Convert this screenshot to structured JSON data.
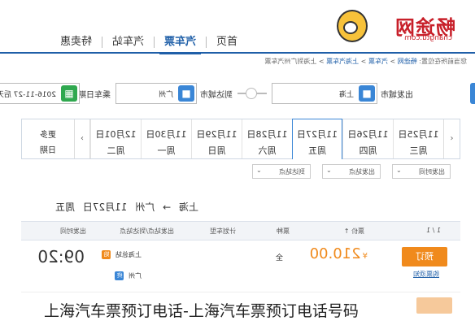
{
  "header": {
    "logo_text": "畅途网",
    "logo_sub": "changtu.com",
    "nav": [
      "首页",
      "汽车票",
      "汽车站",
      "特卖惠"
    ],
    "active_nav": "汽车票"
  },
  "breadcrumb": [
    "您当前所在位置:",
    "畅途网",
    "汽车票",
    "上海汽车票",
    "上海到广州汽车票"
  ],
  "search": {
    "from_label": "出发城市",
    "from_value": "上海",
    "to_label": "到达城市",
    "to_value": "广州",
    "date_label": "乘车日期",
    "date_value": "2016-11-27  后天"
  },
  "date_tabs": [
    {
      "date": "11月25日",
      "day": "周三"
    },
    {
      "date": "11月26日",
      "day": "周四"
    },
    {
      "date": "11月27日",
      "day": "周五",
      "active": true
    },
    {
      "date": "11月28日",
      "day": "周六"
    },
    {
      "date": "11月29日",
      "day": "周日"
    },
    {
      "date": "11月30日",
      "day": "周一"
    },
    {
      "date": "12月01日",
      "day": "周二"
    }
  ],
  "more_dates": {
    "line1": "更多",
    "line2": "日期"
  },
  "filters": [
    "出发时间",
    "出发站点",
    "到达站点"
  ],
  "route": {
    "from": "上海",
    "arrow": "→",
    "to": "广州",
    "date": "11月27日",
    "day": "周五"
  },
  "table": {
    "headers": [
      "出发时间",
      "出发站点/到达站点",
      "计划车型",
      "票种",
      "票价 ↑",
      "1 / 1"
    ],
    "row": {
      "time": "09:20",
      "depart_station": "上海总站",
      "depart_badge": "始",
      "arrive_station": "广州",
      "arrive_badge": "终",
      "seat": "全",
      "price_unit": "¥",
      "price": "210.00",
      "book_label": "预订",
      "notice_label": "购票须知"
    }
  },
  "caption": "上海汽车票预订电话-上海汽车票预订电话号码"
}
